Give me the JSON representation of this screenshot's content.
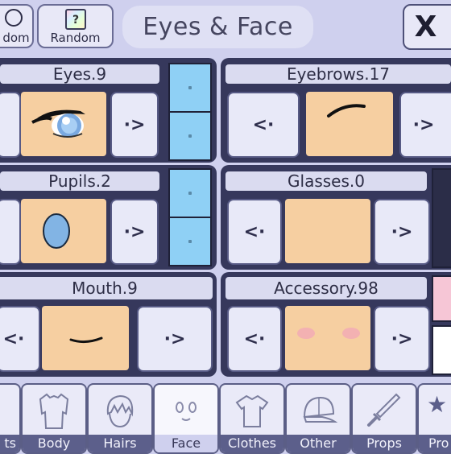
{
  "top": {
    "left_button_label": "dom",
    "random_button_label": "Random",
    "random_icon": "?",
    "title": "Eyes & Face",
    "close_label": "X"
  },
  "panels": [
    {
      "name": "eyes",
      "title": "Eyes.9"
    },
    {
      "name": "eyebrows",
      "title": "Eyebrows.17"
    },
    {
      "name": "pupils",
      "title": "Pupils.2"
    },
    {
      "name": "glasses",
      "title": "Glasses.0"
    },
    {
      "name": "mouth",
      "title": "Mouth.9"
    },
    {
      "name": "accessory",
      "title": "Accessory.98"
    }
  ],
  "arrows": {
    "left": "<·",
    "right": "·>"
  },
  "tabs": [
    {
      "label": "ts",
      "icon": "partial-icon"
    },
    {
      "label": "Body",
      "icon": "body-icon"
    },
    {
      "label": "Hairs",
      "icon": "hair-icon"
    },
    {
      "label": "Face",
      "icon": "face-icon"
    },
    {
      "label": "Clothes",
      "icon": "shirt-icon"
    },
    {
      "label": "Other",
      "icon": "cap-icon"
    },
    {
      "label": "Props",
      "icon": "sword-icon"
    },
    {
      "label": "Pro",
      "icon": "star-icon"
    }
  ],
  "colors": {
    "background": "#cfd0ee",
    "panel": "#36385c",
    "preview": "#f6cfa1",
    "swatch_blue": "#8fd0f5",
    "swatch_pink": "#f6c6d6",
    "swatch_white": "#ffffff",
    "tab_label_bg": "#5c5f8b"
  },
  "active_tab": "Face"
}
